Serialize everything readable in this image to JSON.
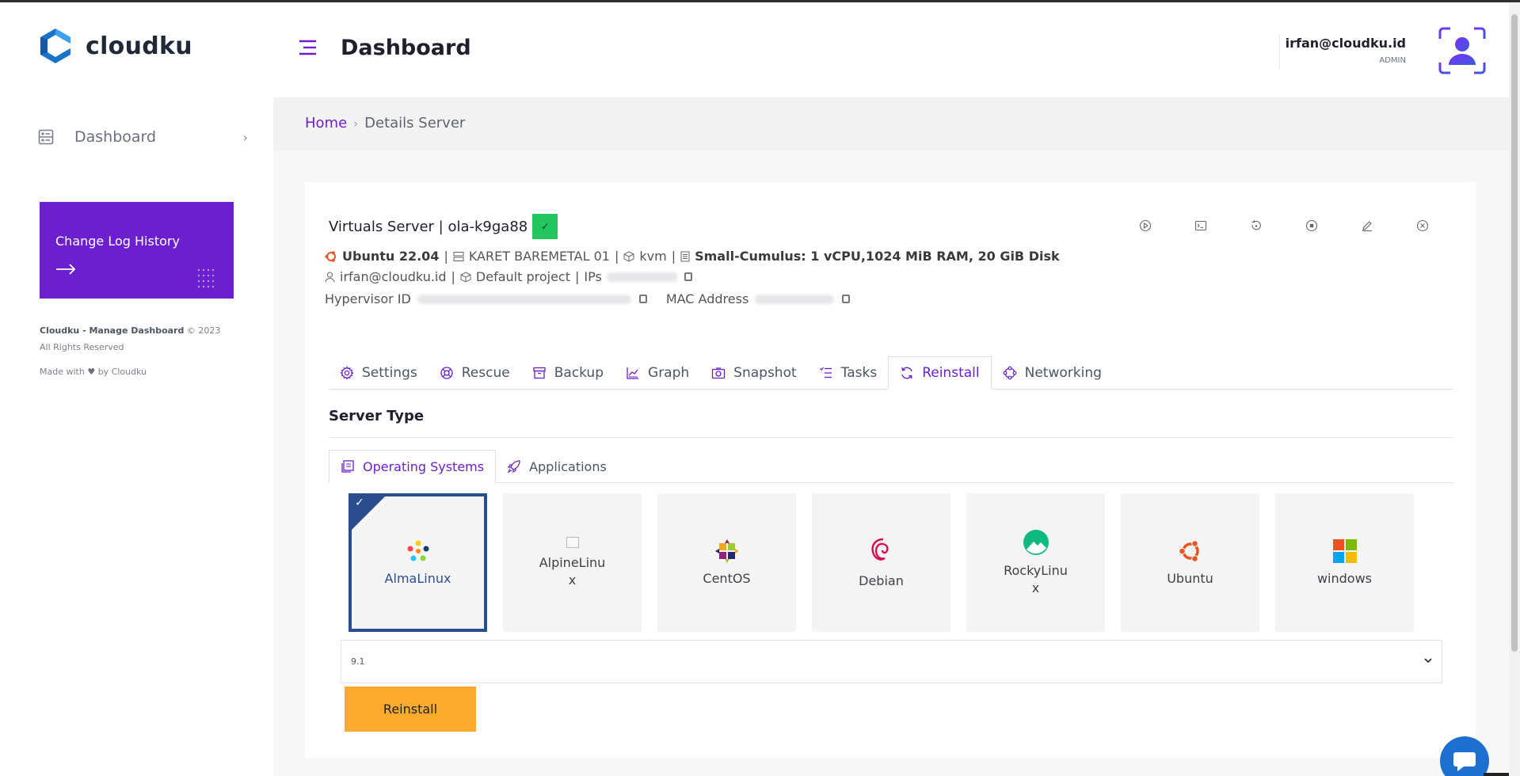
{
  "brand": {
    "name": "cloudku"
  },
  "sidebar": {
    "items": [
      {
        "label": "Dashboard"
      }
    ],
    "changelog": {
      "label": "Change Log History"
    },
    "footer": {
      "company": "Cloudku - Manage Dashboard",
      "copyright": "© 2023",
      "rights": "All Rights Reserved",
      "made_with_prefix": "Made with",
      "made_with_suffix": "by Cloudku"
    }
  },
  "header": {
    "title": "Dashboard",
    "user_email": "irfan@cloudku.id",
    "user_role": "ADMIN"
  },
  "breadcrumb": {
    "home": "Home",
    "separator": "›",
    "current": "Details Server"
  },
  "server": {
    "title": "Virtuals Server | ola-k9ga88",
    "os": "Ubuntu 22.04",
    "location": "KARET BAREMETAL 01",
    "virt": "kvm",
    "plan": "Small-Cumulus: 1 vCPU,1024 MiB RAM, 20 GiB Disk",
    "owner": "irfan@cloudku.id",
    "project": "Default project",
    "ips_label": "IPs",
    "hypervisor_label": "Hypervisor ID",
    "mac_label": "MAC Address",
    "sep": "|"
  },
  "actions": [
    "play-icon",
    "console-icon",
    "restart-icon",
    "stop-icon",
    "edit-icon",
    "delete-icon"
  ],
  "tabs": [
    {
      "label": "Settings",
      "icon": "gear-icon"
    },
    {
      "label": "Rescue",
      "icon": "lifebuoy-icon"
    },
    {
      "label": "Backup",
      "icon": "archive-icon"
    },
    {
      "label": "Graph",
      "icon": "chart-icon"
    },
    {
      "label": "Snapshot",
      "icon": "camera-icon"
    },
    {
      "label": "Tasks",
      "icon": "tasks-icon"
    },
    {
      "label": "Reinstall",
      "icon": "refresh-icon",
      "active": true
    },
    {
      "label": "Networking",
      "icon": "network-icon"
    }
  ],
  "section": {
    "title": "Server Type"
  },
  "subtabs": [
    {
      "label": "Operating Systems",
      "active": true
    },
    {
      "label": "Applications"
    }
  ],
  "os_options": [
    {
      "name": "AlmaLinux",
      "selected": true
    },
    {
      "name": "AlpineLinux"
    },
    {
      "name": "CentOS"
    },
    {
      "name": "Debian"
    },
    {
      "name": "RockyLinux"
    },
    {
      "name": "Ubuntu"
    },
    {
      "name": "windows"
    }
  ],
  "version_select": {
    "value": "9.1"
  },
  "reinstall_button": {
    "label": "Reinstall"
  },
  "colors": {
    "accent": "#6c1fcf",
    "selected_border": "#2a4d8f",
    "button": "#fdab2e",
    "status_ok": "#22c55e"
  }
}
